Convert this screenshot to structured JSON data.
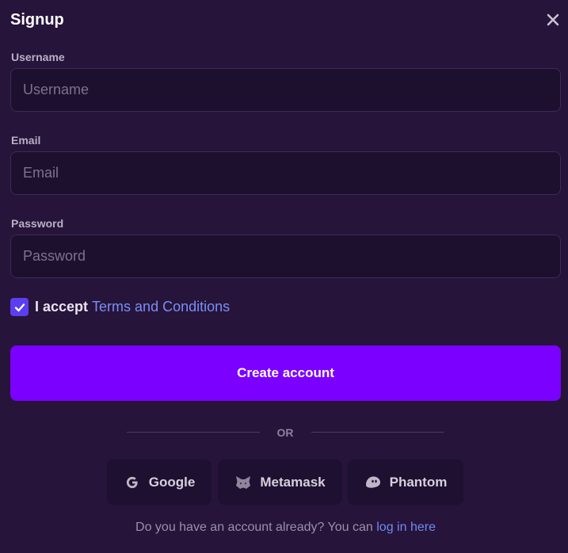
{
  "dialog": {
    "title": "Signup"
  },
  "form": {
    "username": {
      "label": "Username",
      "placeholder": "Username",
      "value": ""
    },
    "email": {
      "label": "Email",
      "placeholder": "Email",
      "value": ""
    },
    "password": {
      "label": "Password",
      "placeholder": "Password",
      "value": ""
    },
    "terms": {
      "checked": true,
      "prefix": "I accept ",
      "link_text": "Terms and Conditions"
    },
    "submit_label": "Create account"
  },
  "divider": {
    "text": "OR"
  },
  "social": [
    {
      "label": "Google",
      "icon": "google-icon"
    },
    {
      "label": "Metamask",
      "icon": "metamask-icon"
    },
    {
      "label": "Phantom",
      "icon": "phantom-icon"
    }
  ],
  "footer": {
    "prefix": "Do you have an account already? You can ",
    "link_text": "log in here"
  },
  "colors": {
    "background": "#26143a",
    "input_background": "#1d0f2e",
    "primary_button": "#7b00ff",
    "checkbox": "#5a3ef0",
    "link": "#7a8ff5"
  }
}
